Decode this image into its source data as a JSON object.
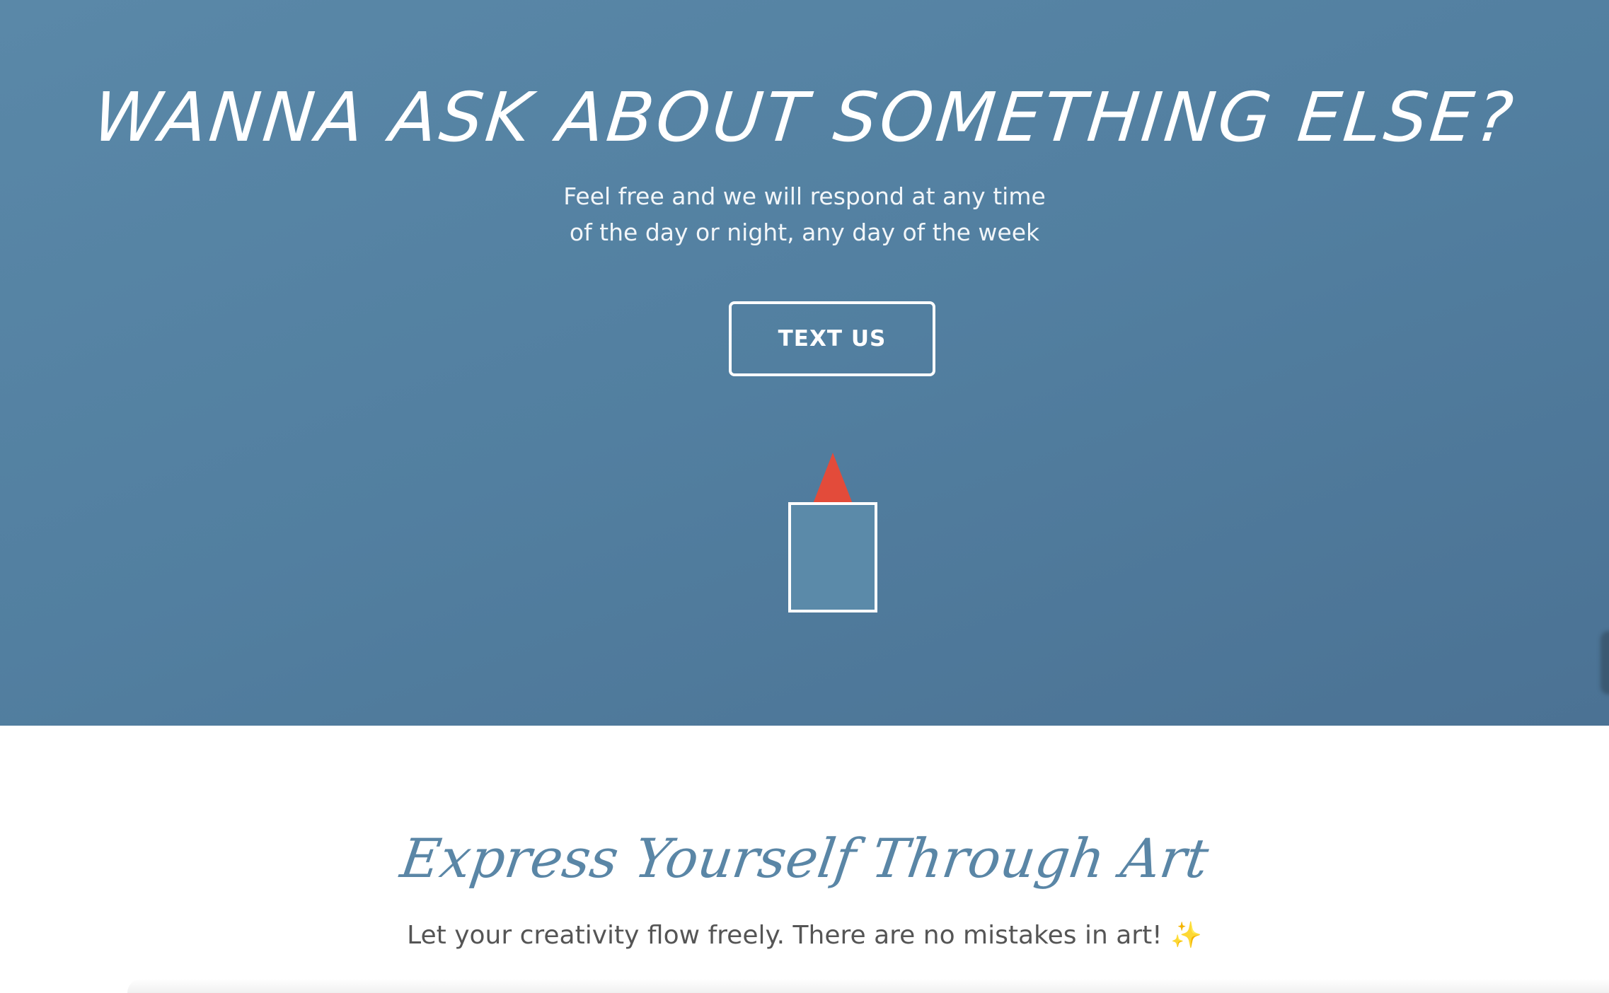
{
  "hero": {
    "title": "WANNA ASK ABOUT SOMETHING ELSE?",
    "subtitle_line1": "Feel free and we will respond at any time",
    "subtitle_line2": "of the day or night, any day of the week",
    "button_label": "TEXT US",
    "rocket_icon": "rocket-icon",
    "colors": {
      "background": "#527fa0",
      "rocket_tip": "#e34b3a",
      "rocket_body": "#5b8aa9",
      "text": "#ffffff"
    }
  },
  "section": {
    "title": "Express Yourself Through Art",
    "subtitle": "Let your creativity flow freely. There are no mistakes in art!",
    "sparkle_icon": "sparkles-icon",
    "sparkle_glyph": "✨",
    "colors": {
      "title": "#5a86a6",
      "subtitle": "#555555"
    }
  }
}
